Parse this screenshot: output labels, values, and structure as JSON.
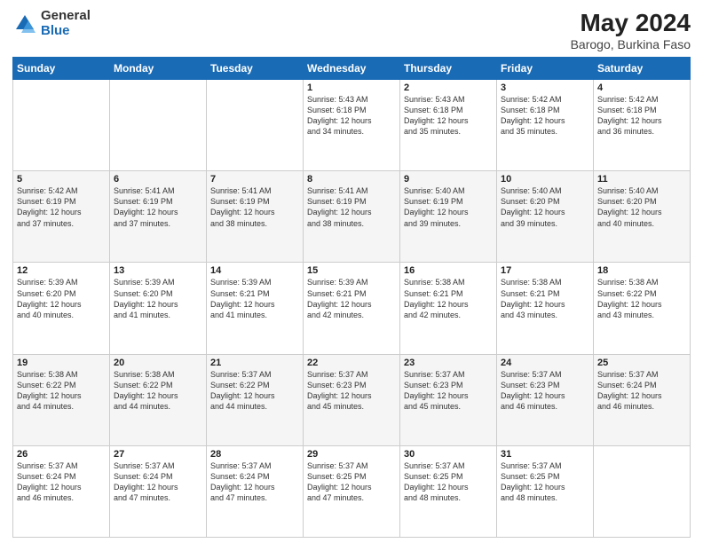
{
  "header": {
    "logo_general": "General",
    "logo_blue": "Blue",
    "title": "May 2024",
    "location": "Barogo, Burkina Faso"
  },
  "days_of_week": [
    "Sunday",
    "Monday",
    "Tuesday",
    "Wednesday",
    "Thursday",
    "Friday",
    "Saturday"
  ],
  "weeks": [
    [
      {
        "day": "",
        "info": ""
      },
      {
        "day": "",
        "info": ""
      },
      {
        "day": "",
        "info": ""
      },
      {
        "day": "1",
        "info": "Sunrise: 5:43 AM\nSunset: 6:18 PM\nDaylight: 12 hours\nand 34 minutes."
      },
      {
        "day": "2",
        "info": "Sunrise: 5:43 AM\nSunset: 6:18 PM\nDaylight: 12 hours\nand 35 minutes."
      },
      {
        "day": "3",
        "info": "Sunrise: 5:42 AM\nSunset: 6:18 PM\nDaylight: 12 hours\nand 35 minutes."
      },
      {
        "day": "4",
        "info": "Sunrise: 5:42 AM\nSunset: 6:18 PM\nDaylight: 12 hours\nand 36 minutes."
      }
    ],
    [
      {
        "day": "5",
        "info": "Sunrise: 5:42 AM\nSunset: 6:19 PM\nDaylight: 12 hours\nand 37 minutes."
      },
      {
        "day": "6",
        "info": "Sunrise: 5:41 AM\nSunset: 6:19 PM\nDaylight: 12 hours\nand 37 minutes."
      },
      {
        "day": "7",
        "info": "Sunrise: 5:41 AM\nSunset: 6:19 PM\nDaylight: 12 hours\nand 38 minutes."
      },
      {
        "day": "8",
        "info": "Sunrise: 5:41 AM\nSunset: 6:19 PM\nDaylight: 12 hours\nand 38 minutes."
      },
      {
        "day": "9",
        "info": "Sunrise: 5:40 AM\nSunset: 6:19 PM\nDaylight: 12 hours\nand 39 minutes."
      },
      {
        "day": "10",
        "info": "Sunrise: 5:40 AM\nSunset: 6:20 PM\nDaylight: 12 hours\nand 39 minutes."
      },
      {
        "day": "11",
        "info": "Sunrise: 5:40 AM\nSunset: 6:20 PM\nDaylight: 12 hours\nand 40 minutes."
      }
    ],
    [
      {
        "day": "12",
        "info": "Sunrise: 5:39 AM\nSunset: 6:20 PM\nDaylight: 12 hours\nand 40 minutes."
      },
      {
        "day": "13",
        "info": "Sunrise: 5:39 AM\nSunset: 6:20 PM\nDaylight: 12 hours\nand 41 minutes."
      },
      {
        "day": "14",
        "info": "Sunrise: 5:39 AM\nSunset: 6:21 PM\nDaylight: 12 hours\nand 41 minutes."
      },
      {
        "day": "15",
        "info": "Sunrise: 5:39 AM\nSunset: 6:21 PM\nDaylight: 12 hours\nand 42 minutes."
      },
      {
        "day": "16",
        "info": "Sunrise: 5:38 AM\nSunset: 6:21 PM\nDaylight: 12 hours\nand 42 minutes."
      },
      {
        "day": "17",
        "info": "Sunrise: 5:38 AM\nSunset: 6:21 PM\nDaylight: 12 hours\nand 43 minutes."
      },
      {
        "day": "18",
        "info": "Sunrise: 5:38 AM\nSunset: 6:22 PM\nDaylight: 12 hours\nand 43 minutes."
      }
    ],
    [
      {
        "day": "19",
        "info": "Sunrise: 5:38 AM\nSunset: 6:22 PM\nDaylight: 12 hours\nand 44 minutes."
      },
      {
        "day": "20",
        "info": "Sunrise: 5:38 AM\nSunset: 6:22 PM\nDaylight: 12 hours\nand 44 minutes."
      },
      {
        "day": "21",
        "info": "Sunrise: 5:37 AM\nSunset: 6:22 PM\nDaylight: 12 hours\nand 44 minutes."
      },
      {
        "day": "22",
        "info": "Sunrise: 5:37 AM\nSunset: 6:23 PM\nDaylight: 12 hours\nand 45 minutes."
      },
      {
        "day": "23",
        "info": "Sunrise: 5:37 AM\nSunset: 6:23 PM\nDaylight: 12 hours\nand 45 minutes."
      },
      {
        "day": "24",
        "info": "Sunrise: 5:37 AM\nSunset: 6:23 PM\nDaylight: 12 hours\nand 46 minutes."
      },
      {
        "day": "25",
        "info": "Sunrise: 5:37 AM\nSunset: 6:24 PM\nDaylight: 12 hours\nand 46 minutes."
      }
    ],
    [
      {
        "day": "26",
        "info": "Sunrise: 5:37 AM\nSunset: 6:24 PM\nDaylight: 12 hours\nand 46 minutes."
      },
      {
        "day": "27",
        "info": "Sunrise: 5:37 AM\nSunset: 6:24 PM\nDaylight: 12 hours\nand 47 minutes."
      },
      {
        "day": "28",
        "info": "Sunrise: 5:37 AM\nSunset: 6:24 PM\nDaylight: 12 hours\nand 47 minutes."
      },
      {
        "day": "29",
        "info": "Sunrise: 5:37 AM\nSunset: 6:25 PM\nDaylight: 12 hours\nand 47 minutes."
      },
      {
        "day": "30",
        "info": "Sunrise: 5:37 AM\nSunset: 6:25 PM\nDaylight: 12 hours\nand 48 minutes."
      },
      {
        "day": "31",
        "info": "Sunrise: 5:37 AM\nSunset: 6:25 PM\nDaylight: 12 hours\nand 48 minutes."
      },
      {
        "day": "",
        "info": ""
      }
    ]
  ]
}
